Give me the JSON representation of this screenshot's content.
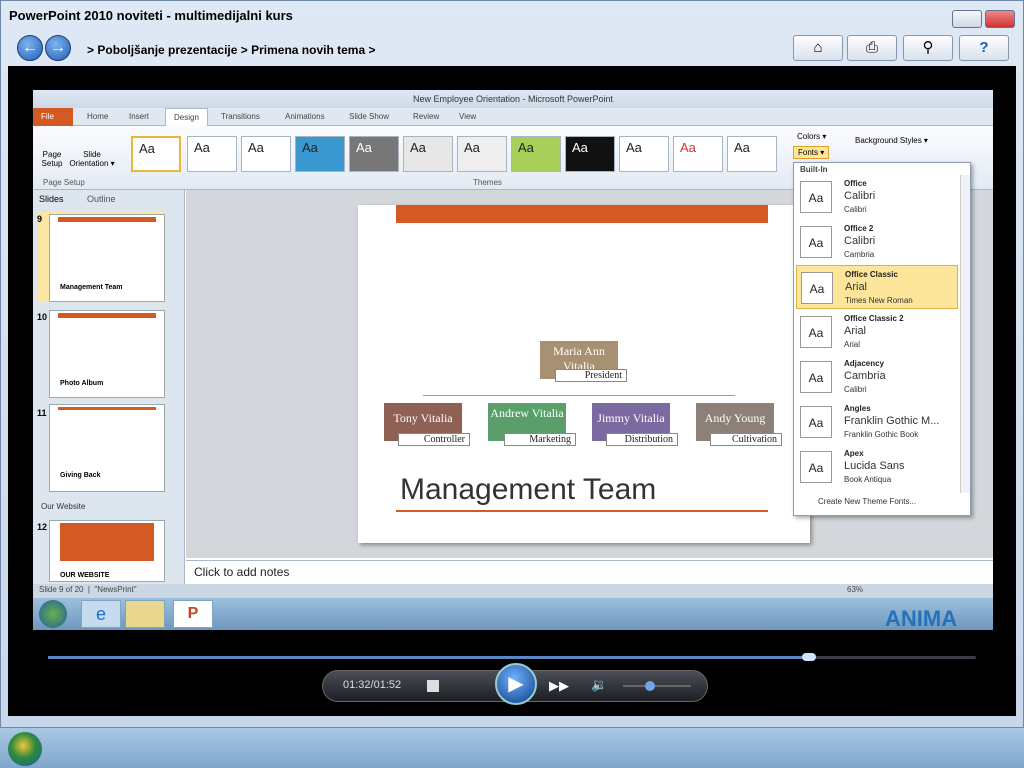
{
  "window": {
    "title": "PowerPoint 2010 noviteti - multimedijalni kurs"
  },
  "nav": {
    "crumb1": "Poboljšanje prezentacije",
    "crumb2": "Primena novih tema",
    "sep": ">"
  },
  "ppt": {
    "title": "New Employee Orientation - Microsoft PowerPoint",
    "tabs": [
      "File",
      "Home",
      "Insert",
      "Design",
      "Transitions",
      "Animations",
      "Slide Show",
      "Review",
      "View"
    ],
    "page_setup": [
      "Page Setup",
      "Slide Orientation ▾"
    ],
    "group_page_setup": "Page Setup",
    "group_themes": "Themes",
    "colors": "Colors ▾",
    "fonts": "Fonts ▾",
    "bg_styles": "Background Styles ▾",
    "pane_tabs": [
      "Slides",
      "Outline"
    ],
    "thumbs": [
      {
        "num": "9",
        "caption": "Management Team"
      },
      {
        "num": "10",
        "caption": "Photo Album"
      },
      {
        "num": "11",
        "caption": "Giving Back"
      },
      {
        "num": "12",
        "caption": "OUR WEBSITE"
      }
    ],
    "section": "Our Website",
    "notes": "Click to add notes",
    "status": {
      "slide": "Slide 9 of 20",
      "theme": "\"NewsPrint\"",
      "zoom": "63%"
    }
  },
  "slide": {
    "title": "Management Team",
    "top": {
      "name": "Maria Ann Vitalia",
      "role": "President"
    },
    "people": [
      {
        "name": "Tony Vitalia",
        "role": "Controller",
        "color": "#8f6155"
      },
      {
        "name": "Andrew Vitalia",
        "role": "Marketing",
        "color": "#5a9e6b"
      },
      {
        "name": "Jimmy Vitalia",
        "role": "Distribution",
        "color": "#7b6aa1"
      },
      {
        "name": "Andy Young",
        "role": "Cultivation",
        "color": "#8c8079"
      }
    ]
  },
  "fonts_dropdown": {
    "header": "Built-In",
    "items": [
      {
        "name": "Office",
        "h": "Calibri",
        "b": "Calibri"
      },
      {
        "name": "Office 2",
        "h": "Calibri",
        "b": "Cambria"
      },
      {
        "name": "Office Classic",
        "h": "Arial",
        "b": "Times New Roman"
      },
      {
        "name": "Office Classic 2",
        "h": "Arial",
        "b": "Arial"
      },
      {
        "name": "Adjacency",
        "h": "Cambria",
        "b": "Calibri"
      },
      {
        "name": "Angles",
        "h": "Franklin Gothic M...",
        "b": "Franklin Gothic Book"
      },
      {
        "name": "Apex",
        "h": "Lucida Sans",
        "b": "Book Antiqua"
      }
    ],
    "footer": "Create New Theme Fonts..."
  },
  "player": {
    "time": "01:32/01:52",
    "progress": 0.82,
    "volume": 0.4
  },
  "watermark": "ANIMA",
  "colors": {
    "accent": "#d35a23"
  }
}
